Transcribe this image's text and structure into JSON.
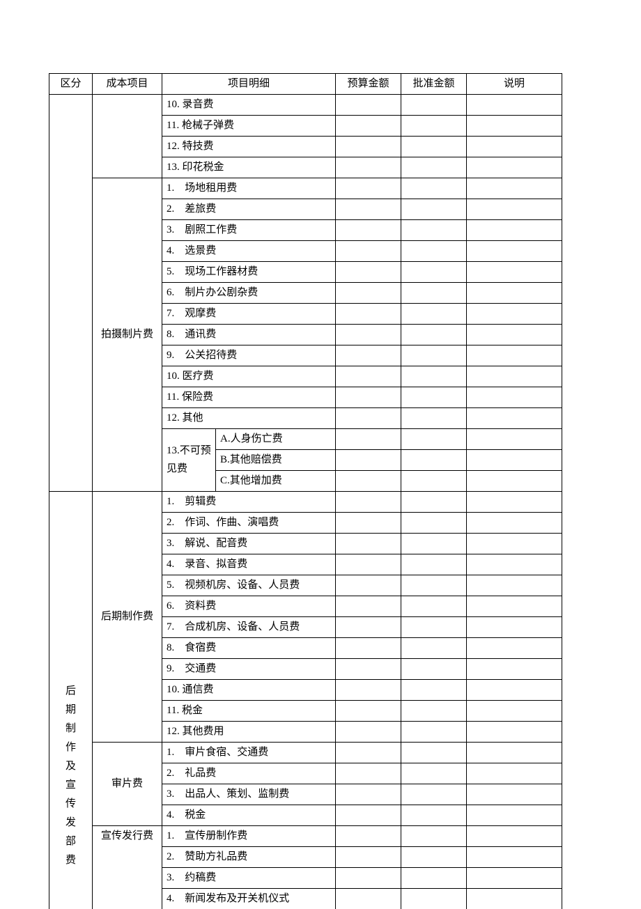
{
  "headers": {
    "category": "区分",
    "cost_item": "成本项目",
    "detail": "项目明细",
    "budget": "预算金额",
    "approved": "批准金额",
    "note": "说明"
  },
  "section1": {
    "pre_items": {
      "i10": "10. 录音费",
      "i11": "11. 枪械子弹费",
      "i12": "12. 特技费",
      "i13": "13. 印花税金"
    },
    "shoot": {
      "label": "拍摄制片费",
      "i1": "1.　场地租用费",
      "i2": "2.　差旅费",
      "i3": "3.　剧照工作费",
      "i4": "4.　选景费",
      "i5": "5.　现场工作器材费",
      "i6": "6.　制片办公剧杂费",
      "i7": "7.　观摩费",
      "i8": "8.　通讯费",
      "i9": "9.　公关招待费",
      "i10": "10. 医疗费",
      "i11": "11. 保险费",
      "i12": "12. 其他",
      "i13_label": "13.不可预见费",
      "i13a": "A.人身伤亡费",
      "i13b": "B.其他赔偿费",
      "i13c": "C.其他增加费"
    }
  },
  "section2": {
    "category_label": "后期制作及宣传发部费",
    "post": {
      "label": "后期制作费",
      "i1": "1.　剪辑费",
      "i2": "2.　作词、作曲、演唱费",
      "i3": "3.　解说、配音费",
      "i4": "4.　录音、拟音费",
      "i5": "5.　视频机房、设备、人员费",
      "i6": "6.　资料费",
      "i7": "7.　合成机房、设备、人员费",
      "i8": "8.　食宿费",
      "i9": "9.　交通费",
      "i10": "10. 通信费",
      "i11": "11. 税金",
      "i12": "12. 其他费用"
    },
    "review": {
      "label": "审片费",
      "i1": "1.　审片食宿、交通费",
      "i2": "2.　礼品费",
      "i3": "3.　出品人、策划、监制费",
      "i4": "4.　税金"
    },
    "promo": {
      "label": "宣传发行费",
      "i1": "1.　宣传册制作费",
      "i2": "2.　赞助方礼品费",
      "i3": "3.　约稿费",
      "i4": "4.　新闻发布及开关机仪式"
    }
  }
}
